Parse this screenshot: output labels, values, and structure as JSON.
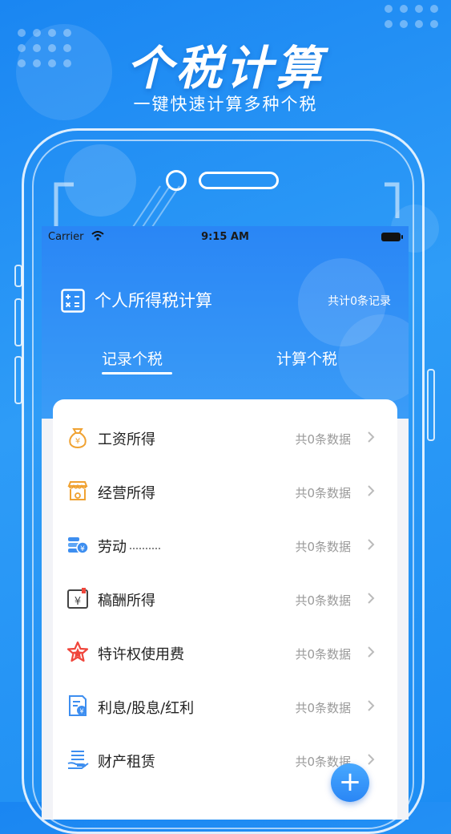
{
  "promo": {
    "title": "个税计算",
    "subtitle": "一键快速计算多种个税"
  },
  "status_bar": {
    "carrier": "Carrier",
    "time": "9:15 AM"
  },
  "header": {
    "title": "个人所得税计算",
    "record_count": "共计0条记录"
  },
  "tabs": [
    {
      "label": "记录个税",
      "active": true
    },
    {
      "label": "计算个税",
      "active": false
    }
  ],
  "income_items": [
    {
      "label": "工资所得",
      "count": "共0条数据",
      "icon": "money-bag-icon"
    },
    {
      "label": "经营所得",
      "count": "共0条数据",
      "icon": "shop-icon"
    },
    {
      "label": "劳动",
      "count": "共0条数据",
      "icon": "coins-icon"
    },
    {
      "label": "稿酬所得",
      "count": "共0条数据",
      "icon": "calendar-yen-icon"
    },
    {
      "label": "特许权使用费",
      "count": "共0条数据",
      "icon": "star-badge-icon"
    },
    {
      "label": "利息/股息/红利",
      "count": "共0条数据",
      "icon": "bill-icon"
    },
    {
      "label": "财产租赁",
      "count": "共0条数据",
      "icon": "hand-cash-icon"
    }
  ],
  "fab": {
    "label": "+"
  },
  "colors": {
    "primary": "#2a86f5",
    "accent_orange": "#f0a232",
    "accent_blue": "#3d8ef0",
    "accent_red": "#f0463c"
  }
}
